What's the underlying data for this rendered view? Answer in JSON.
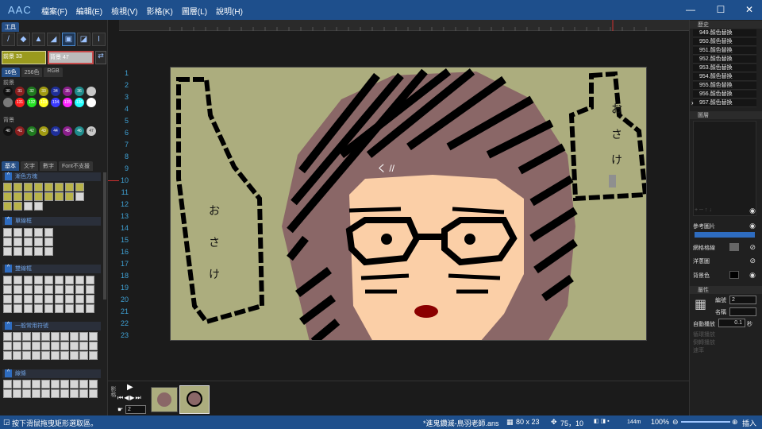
{
  "app": {
    "logo": "AAC",
    "menus": [
      "檔案(F)",
      "編輯(E)",
      "檢視(V)",
      "影格(K)",
      "圖層(L)",
      "說明(H)"
    ],
    "window_controls": {
      "minimize": "—",
      "maximize": "☐",
      "close": "✕"
    }
  },
  "left": {
    "tools_tab": "工具",
    "fg_label": "前景 33",
    "bg_label": "背景 47",
    "palette_tabs": [
      "16色",
      "256色",
      "RGB"
    ],
    "fg_section": "前景",
    "bg_section": "背景",
    "fg_swatches": [
      {
        "c": "#111111",
        "t": "30"
      },
      {
        "c": "#8b1f1f",
        "t": "31"
      },
      {
        "c": "#1f7a1f",
        "t": "32"
      },
      {
        "c": "#a09a12",
        "t": "33"
      },
      {
        "c": "#1f2f9a",
        "t": "34"
      },
      {
        "c": "#8b1f8b",
        "t": "35"
      },
      {
        "c": "#1f8b8b",
        "t": "36"
      },
      {
        "c": "#c8c8c8",
        "t": ""
      },
      {
        "c": "#7a7a7a",
        "t": ""
      },
      {
        "c": "#ff2020",
        "t": "131"
      },
      {
        "c": "#22e022",
        "t": "132"
      },
      {
        "c": "#ffff22",
        "t": "133"
      },
      {
        "c": "#3a3aff",
        "t": "134"
      },
      {
        "c": "#ff22ff",
        "t": "135"
      },
      {
        "c": "#22ffff",
        "t": "136"
      },
      {
        "c": "#ffffff",
        "t": ""
      }
    ],
    "bg_swatches": [
      {
        "c": "#111111",
        "t": "40"
      },
      {
        "c": "#8b1f1f",
        "t": "41"
      },
      {
        "c": "#1f7a1f",
        "t": "42"
      },
      {
        "c": "#a09a12",
        "t": "43"
      },
      {
        "c": "#1f2f9a",
        "t": "44"
      },
      {
        "c": "#8b1f8b",
        "t": "45"
      },
      {
        "c": "#1f8b8b",
        "t": "46"
      },
      {
        "c": "#c8c8c8",
        "t": "47"
      }
    ],
    "shape_tabs": [
      "基本",
      "文字",
      "數字",
      "Font不支援"
    ],
    "categories": [
      "漸色方塊",
      "單線框",
      "雙線框",
      "一般常用符號",
      "線條"
    ]
  },
  "canvas": {
    "row_numbers": [
      "1",
      "2",
      "3",
      "4",
      "5",
      "6",
      "7",
      "8",
      "9",
      "10",
      "11",
      "12",
      "13",
      "14",
      "15",
      "16",
      "17",
      "18",
      "19",
      "20",
      "21",
      "22",
      "23"
    ],
    "left_text": [
      "お",
      "さ",
      "け"
    ],
    "right_text": [
      "お",
      "さ",
      "け"
    ],
    "scribble": "く //"
  },
  "right": {
    "history_header": "歷史",
    "history": [
      "949.顏色替換",
      "950.顏色替換",
      "951.顏色替換",
      "952.顏色替換",
      "953.顏色替換",
      "954.顏色替換",
      "955.顏色替換",
      "956.顏色替換",
      "957.顏色替換"
    ],
    "layers_header": "圖層",
    "ref_image": "參考圖片",
    "grid_lines": "網格格線",
    "onion_skin": "洋蔥圖",
    "bg_color": "背景色",
    "props_header": "屬性",
    "frame_no_label": "編號",
    "frame_no": "2",
    "name_label": "名稱",
    "name_value": "",
    "autoplay_label": "自動播放",
    "autoplay_value": "0.1",
    "autoplay_unit": "秒",
    "disabled_rows": [
      "循環播放",
      "倒轉播放",
      "速率"
    ]
  },
  "timeline": {
    "frame_count": "2",
    "frame_label": "影格"
  },
  "status": {
    "hint": "按下滑鼠拖曳矩形選取區。",
    "file": "*進鬼鑽滅-鳥羽老師.ans",
    "grid": "80 x 23",
    "cursor": "75，10",
    "mode": "144m",
    "zoom": "100%",
    "insert": "插入"
  }
}
